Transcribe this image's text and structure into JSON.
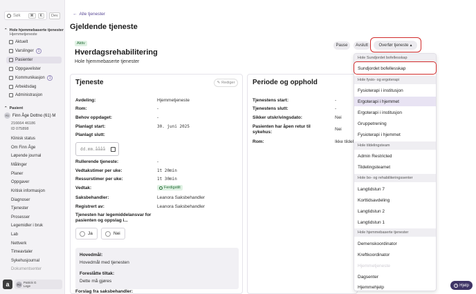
{
  "search": {
    "placeholder": "Søk",
    "kbd1": "⌘",
    "kbd2": "K",
    "dev": "Dev"
  },
  "org": {
    "title": "Hole hjemmebaserte tjenester",
    "subtitle": "Hjemmetjeneste"
  },
  "org_nav": [
    {
      "label": "Aktuelt",
      "icon": "house-icon"
    },
    {
      "label": "Varslinger",
      "icon": "bell-icon",
      "count": "1"
    },
    {
      "label": "Pasienter",
      "icon": "people-icon",
      "active": true
    },
    {
      "label": "Oppgavelister",
      "icon": "list-icon"
    },
    {
      "label": "Kommunikasjon",
      "icon": "chat-icon",
      "count": "1"
    },
    {
      "label": "Arbeidsdag",
      "icon": "calendar-icon"
    },
    {
      "label": "Administrasjon",
      "icon": "gear-icon"
    }
  ],
  "patient": {
    "section": "Pasient",
    "name": "Finn Åge Dottno (61) M",
    "initials": "FD",
    "id1": "216664 46186",
    "id2": "ID 075898"
  },
  "patient_nav": [
    "Klinisk status",
    "Om Finn Åge",
    "Løpende journal",
    "Målinger",
    "Planer",
    "Oppgaver",
    "Kritisk informasjon",
    "Diagnoser",
    "Tjenester",
    "Prosesser",
    "Legemidler i bruk",
    "Lab",
    "Nettverk",
    "Timeavtaler",
    "Sykehusjournal",
    "Dokumentsenter"
  ],
  "user": {
    "name": "Patrick G",
    "role": "Lege",
    "initials": "PG"
  },
  "back_label": "Alle tjenester",
  "page_title": "Gjeldende tjeneste",
  "service": {
    "status": "Aktiv",
    "title": "Hverdagsrehabilitering",
    "org": "Hole hjemmebaserte tjenester"
  },
  "actions": {
    "pause": "Pause",
    "avslutt": "Avslutt",
    "overfor": "Overfør tjeneste"
  },
  "tjeneste": {
    "title": "Tjeneste",
    "edit": "Rediger",
    "avdeling_l": "Avdeling:",
    "avdeling_v": "Hjemmetjeneste",
    "rom_l": "Rom:",
    "rom_v": "-",
    "behov_l": "Behov oppdaget:",
    "behov_v": "-",
    "start_l": "Planlagt start:",
    "start_v": "30. juni 2025",
    "slutt_l": "Planlagt slutt:",
    "slutt_ph": "dd.mm.åååå",
    "rull_l": "Rullerende tjeneste:",
    "rull_v": "-",
    "vedtak_l": "Vedtakstimer per uke:",
    "vedtak_v": "1t 20min",
    "ress_l": "Ressurstimer per uke:",
    "ress_v": "1t 30min",
    "vedtakstat_l": "Vedtak:",
    "vedtakstat_v": "Ferdigstilt",
    "saks_l": "Saksbehandler:",
    "saks_v": "Leanora Saksbehandler",
    "reg_l": "Registrert av:",
    "reg_v": "Leanora Saksbehandler",
    "leg_q": "Tjenesten har legemiddelansvar for pasienten og oppslag i...",
    "ja": "Ja",
    "nei": "Nei",
    "hovedmal_l": "Hovedmål:",
    "hovedmal_v": "Hovedmål med tjenesten",
    "tiltak_l": "Foreslåtte tiltak:",
    "tiltak_v": "Dette må gjøres",
    "forslag_l": "Forslag fra saksbehandler:"
  },
  "periode": {
    "title": "Periode og opphold",
    "start_l": "Tjenestens start:",
    "start_v": "-",
    "slutt_l": "Tjenestens slutt:",
    "slutt_v": "-",
    "sikker_l": "Sikker utskrivingsdato:",
    "sikker_v": "Nei",
    "retur_l": "Pasienten har åpen retur til sykehus:",
    "retur_v": "Nei",
    "rom_l": "Rom:",
    "rom_v": "Ikke tildelt"
  },
  "dropdown": {
    "g1": "Hole Sundjordet bofellesskap",
    "i1": "Sundjordet bofellesskap",
    "g2": "Hole fysio- og ergoterapi",
    "i2": "Fysioterapi i institusjon",
    "i3": "Ergoterapi i hjemmet",
    "i4": "Ergoterapi i institusjon",
    "i5": "Gruppetrening",
    "i6": "Fysioterapi i hjemmet",
    "g3": "Hole tildelingsteam",
    "i7": "Admin Restricted",
    "i8": "Tildelingsteamet",
    "g4": "Hole bo- og rehabiliteringssenter",
    "i9": "Langtidstun 7",
    "i10": "Korttidsavdeling",
    "i11": "Langtidstun 2",
    "i12": "Langtidstun 1",
    "g5": "Hole hjemmebaserte tjenester",
    "i13": "Demenskoordinator",
    "i14": "Kreftkoordinator",
    "i15": "Hjemmetjeneste",
    "i16": "Dagsenter",
    "i17": "Hjemmehjelp"
  },
  "help": "Hjelp"
}
